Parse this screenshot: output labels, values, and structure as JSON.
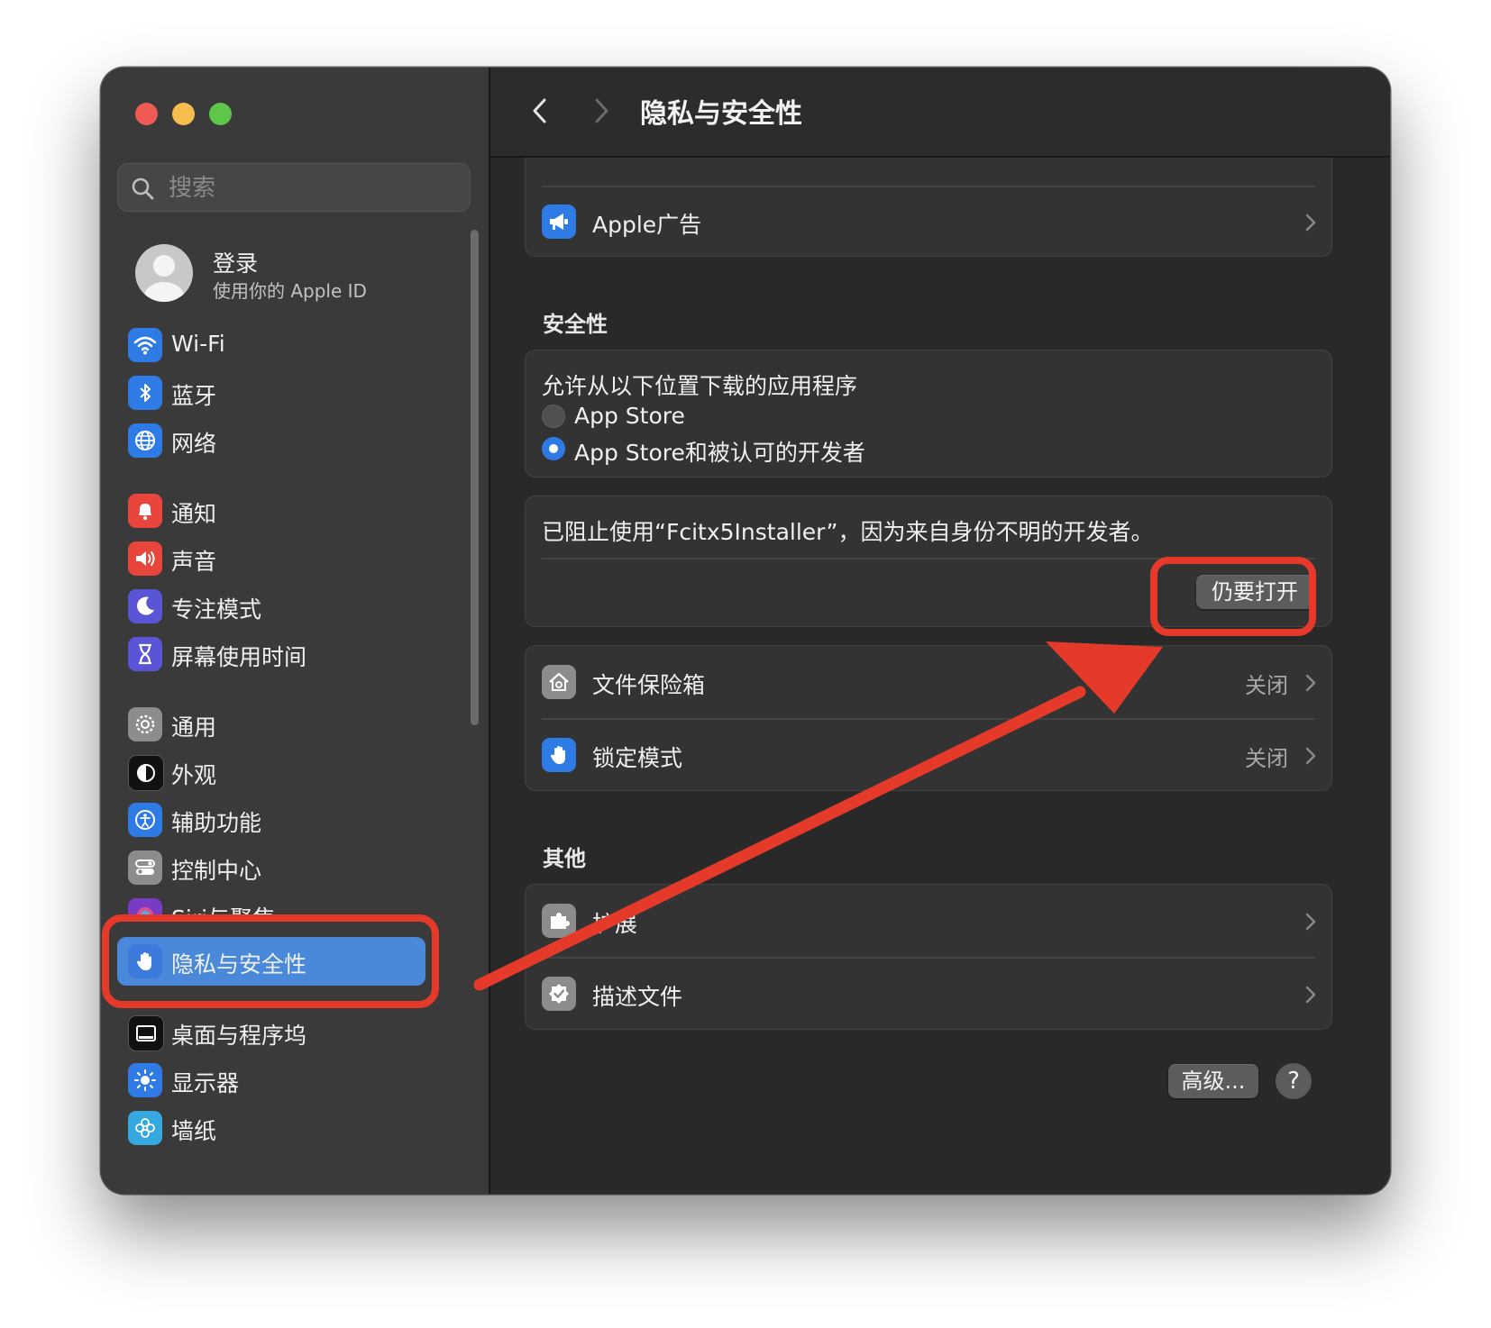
{
  "window": {
    "title": "隐私与安全性"
  },
  "sidebar": {
    "search_placeholder": "搜索",
    "account": {
      "name": "登录",
      "subtitle": "使用你的 Apple ID"
    },
    "items": [
      {
        "label": "Wi-Fi",
        "icon": "wifi-icon",
        "color": "#2f7be5"
      },
      {
        "label": "蓝牙",
        "icon": "bluetooth-icon",
        "color": "#2f7be5"
      },
      {
        "label": "网络",
        "icon": "globe-icon",
        "color": "#2f7be5"
      },
      {
        "label": "通知",
        "icon": "bell-icon",
        "color": "#e8453c"
      },
      {
        "label": "声音",
        "icon": "speaker-icon",
        "color": "#e8453c"
      },
      {
        "label": "专注模式",
        "icon": "moon-icon",
        "color": "#5a55d6"
      },
      {
        "label": "屏幕使用时间",
        "icon": "hourglass-icon",
        "color": "#5a55d6"
      },
      {
        "label": "通用",
        "icon": "gear-icon",
        "color": "#8c8c8c"
      },
      {
        "label": "外观",
        "icon": "appearance-icon",
        "color": "#111111"
      },
      {
        "label": "辅助功能",
        "icon": "accessibility-icon",
        "color": "#2f7be5"
      },
      {
        "label": "控制中心",
        "icon": "control-center-icon",
        "color": "#8c8c8c"
      },
      {
        "label": "Siri与聚焦",
        "icon": "siri-icon",
        "color": "#7a3bc4"
      },
      {
        "label": "隐私与安全性",
        "icon": "hand-icon",
        "color": "#2f7be5",
        "selected": true
      },
      {
        "label": "桌面与程序坞",
        "icon": "dock-icon",
        "color": "#111111"
      },
      {
        "label": "显示器",
        "icon": "sun-icon",
        "color": "#2f7be5"
      },
      {
        "label": "墙纸",
        "icon": "flower-icon",
        "color": "#35a8e0"
      }
    ]
  },
  "main": {
    "apple_ads": {
      "label": "Apple广告",
      "icon": "megaphone-icon"
    },
    "security": {
      "heading": "安全性",
      "allow_title": "允许从以下位置下载的应用程序",
      "options": [
        {
          "label": "App Store",
          "selected": false
        },
        {
          "label": "App Store和被认可的开发者",
          "selected": true
        }
      ],
      "blocked_message": "已阻止使用“Fcitx5Installer”，因为来自身份不明的开发者。",
      "open_anyway": "仍要打开",
      "filevault": {
        "label": "文件保险箱",
        "value": "关闭"
      },
      "lockdown": {
        "label": "锁定模式",
        "value": "关闭"
      }
    },
    "other": {
      "heading": "其他",
      "extensions": {
        "label": "扩展"
      },
      "profiles": {
        "label": "描述文件"
      }
    },
    "advanced_button": "高级...",
    "help_button": "?"
  },
  "annotation": {
    "color": "#e53a2a"
  }
}
